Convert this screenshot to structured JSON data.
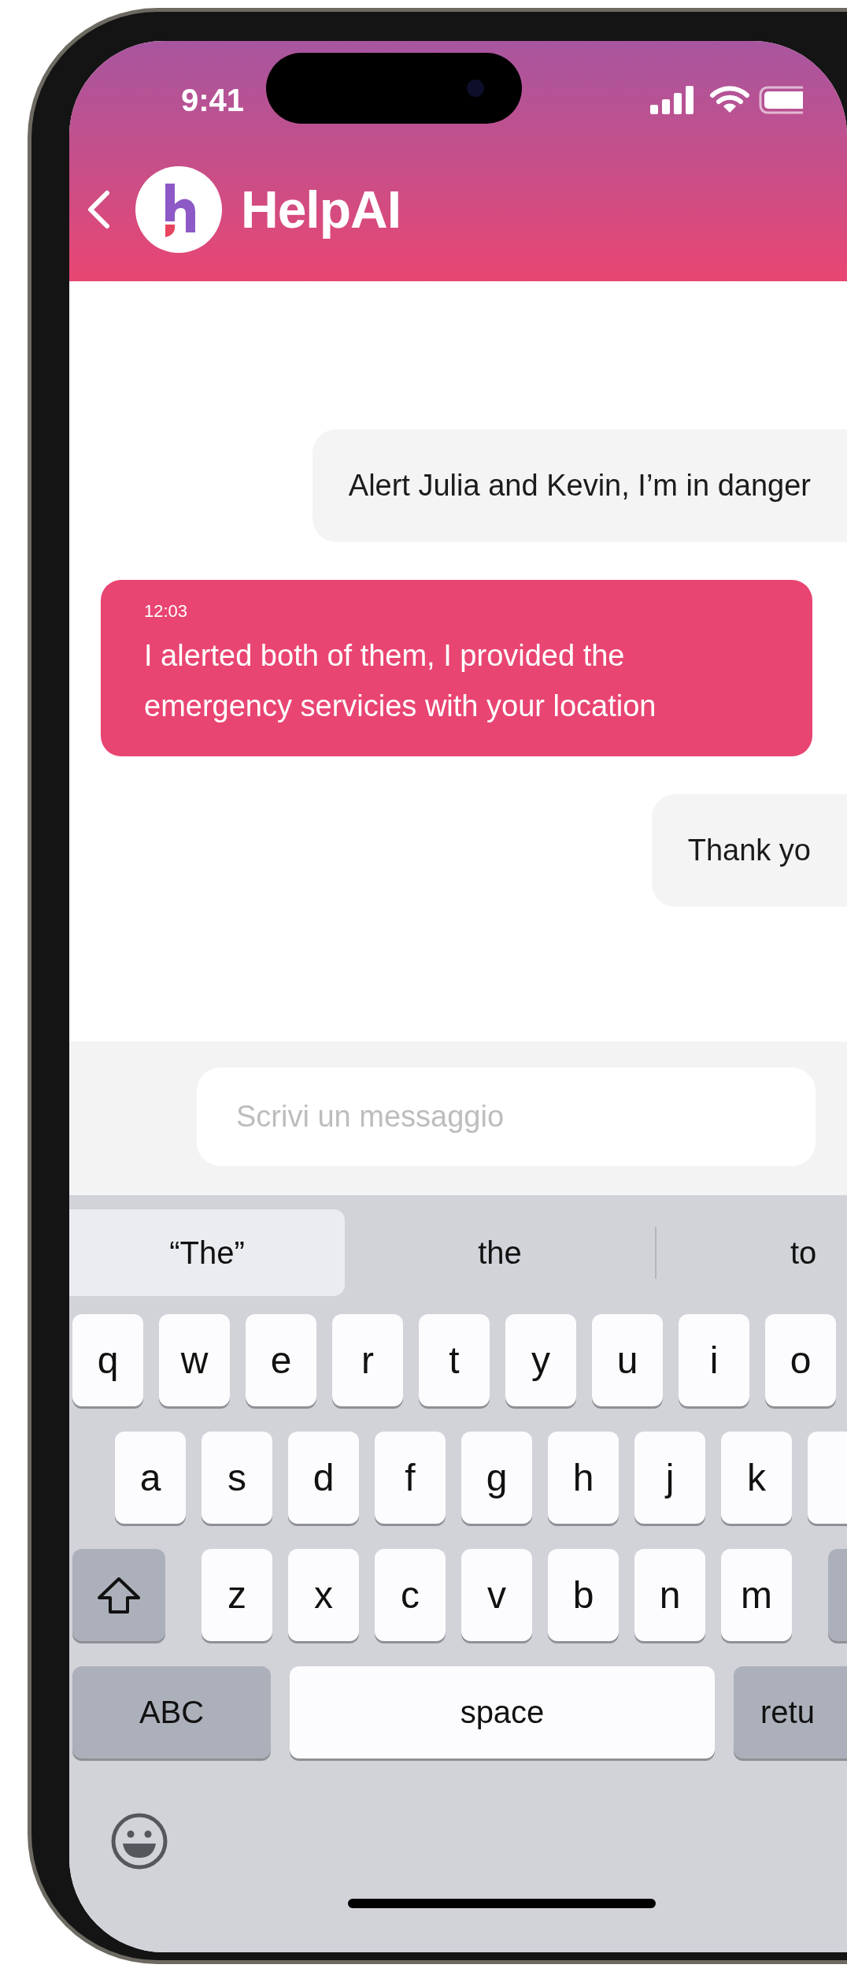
{
  "status_bar": {
    "time": "9:41"
  },
  "header": {
    "title": "HelpAI"
  },
  "messages": [
    {
      "kind": "outgoing",
      "text": "Alert Julia and Kevin, I’m in danger"
    },
    {
      "kind": "incoming",
      "time": "12:03",
      "text": "I alerted both of them, I provided the emergency servicies with your location"
    },
    {
      "kind": "outgoing",
      "text": "Thank yo"
    }
  ],
  "composer": {
    "placeholder": "Scrivi un messaggio"
  },
  "keyboard": {
    "suggestions": [
      {
        "label": "“The”",
        "selected": true
      },
      {
        "label": "the",
        "selected": false
      },
      {
        "label": "to",
        "selected": false
      }
    ],
    "rows": [
      [
        "q",
        "w",
        "e",
        "r",
        "t",
        "y",
        "u",
        "i",
        "o"
      ],
      [
        "a",
        "s",
        "d",
        "f",
        "g",
        "h",
        "j",
        "k"
      ],
      [
        "z",
        "x",
        "c",
        "v",
        "b",
        "n",
        "m"
      ]
    ],
    "bottom_row": [
      {
        "kind": "mode",
        "label": "ABC"
      },
      {
        "kind": "space",
        "label": "space"
      },
      {
        "kind": "return",
        "label": "retu"
      }
    ]
  }
}
